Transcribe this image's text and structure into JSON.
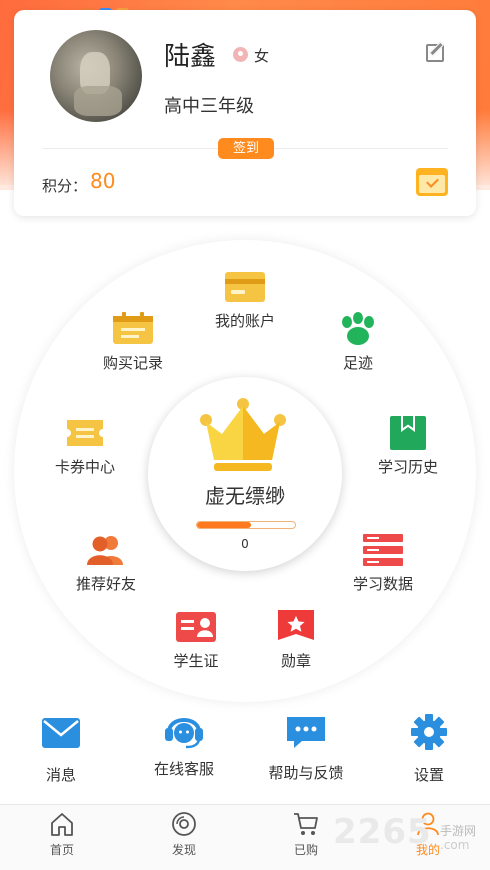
{
  "profile": {
    "name": "陆鑫",
    "gender": "女",
    "grade": "高中三年级",
    "signin_label": "签到",
    "points_label": "积分：",
    "points_value": "80"
  },
  "level": {
    "name": "虚无缥缈",
    "value": "0",
    "progress_fraction": 0.55
  },
  "ring_items": {
    "account": "我的账户",
    "purchase": "购买记录",
    "footprint": "足迹",
    "coupon": "卡券中心",
    "history": "学习历史",
    "recommend": "推荐好友",
    "study_data": "学习数据",
    "student_id": "学生证",
    "medal": "勋章"
  },
  "grid": {
    "message": "消息",
    "service": "在线客服",
    "help": "帮助与反馈",
    "settings": "设置"
  },
  "tabs": {
    "home": "首页",
    "discover": "发现",
    "bought": "已购",
    "mine": "我的"
  },
  "watermark": {
    "main": "2265",
    "sub1": "手游网",
    "sub2": ".com"
  },
  "colors": {
    "accent": "#ff8a1e",
    "header": "#ff7a3a"
  }
}
